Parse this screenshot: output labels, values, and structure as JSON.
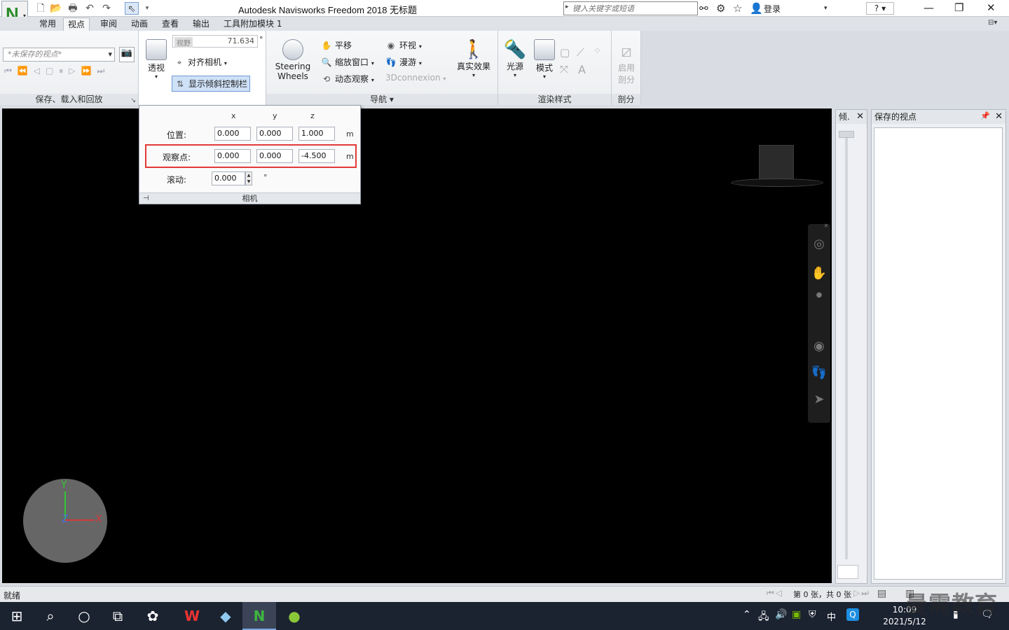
{
  "window": {
    "title": "Autodesk Navisworks Freedom 2018    无标题",
    "search_placeholder": "键入关键字或短语",
    "login": "登录",
    "help": "?"
  },
  "quick_access": [
    "new-icon",
    "open-icon",
    "print-icon",
    "undo-icon",
    "redo-icon",
    "select-icon"
  ],
  "tabs": [
    "常用",
    "视点",
    "审阅",
    "动画",
    "查看",
    "输出",
    "工具附加模块 1"
  ],
  "active_tab": "视点",
  "ribbon": {
    "save_panel": {
      "viewpoint_combo": "*未保存的视点*",
      "title": "保存、载入和回放"
    },
    "camera_panel": {
      "perspective": "透视",
      "fov_label": "视野",
      "fov_value": "71.634",
      "fov_unit": "°",
      "align_camera": "对齐相机",
      "show_tilt": "显示倾斜控制栏"
    },
    "nav_panel": {
      "steering_wheels": "Steering\nWheels",
      "steering_line1": "Steering",
      "steering_line2": "Wheels",
      "pan": "平移",
      "zoom_window": "缩放窗口",
      "orbit": "动态观察",
      "look_around": "环视",
      "walk": "漫游",
      "connexion": "3Dconnexion",
      "realism": "真实效果",
      "title": "导航"
    },
    "render_panel": {
      "lights": "光源",
      "mode": "模式",
      "title": "渲染样式"
    },
    "section_panel": {
      "enable_line1": "启用",
      "enable_line2": "剖分",
      "title": "剖分"
    }
  },
  "camera_popup": {
    "col_x": "x",
    "col_y": "y",
    "col_z": "z",
    "position_label": "位置:",
    "position": [
      "0.000",
      "0.000",
      "1.000"
    ],
    "lookat_label": "观察点:",
    "lookat": [
      "0.000",
      "0.000",
      "-4.500"
    ],
    "unit": "m",
    "roll_label": "滚动:",
    "roll": "0.000",
    "roll_unit": "°",
    "footer": "相机"
  },
  "axes": {
    "y": "Y",
    "z": "Z",
    "x": "X"
  },
  "tilt_panel": {
    "title": "倾."
  },
  "saved_panel": {
    "title": "保存的视点"
  },
  "status": {
    "left": "就绪",
    "pages": "第 0 张，共 0 张"
  },
  "clock": {
    "time": "10:09",
    "date": "2021/5/12"
  },
  "tray": {
    "ime": "中"
  },
  "watermark": "曼需教育"
}
